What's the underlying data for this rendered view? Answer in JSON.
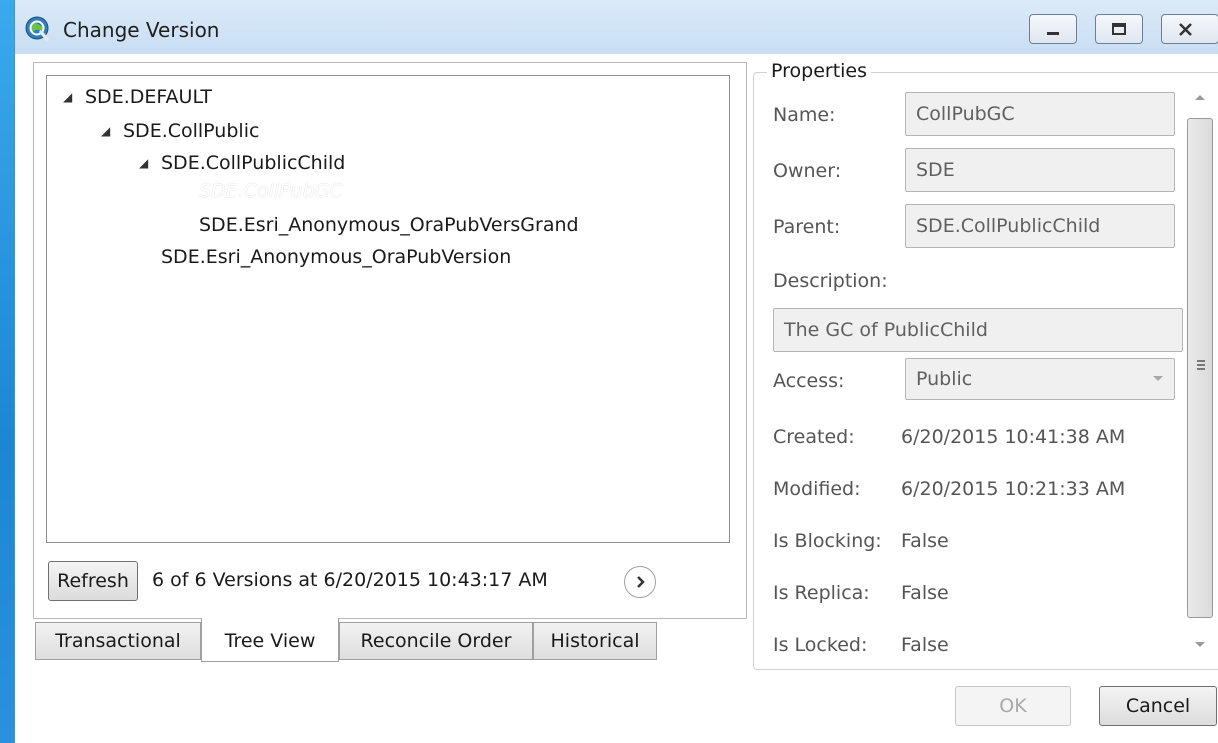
{
  "window": {
    "title": "Change Version"
  },
  "tree": {
    "nodes": [
      {
        "label": "SDE.DEFAULT",
        "expanded": true
      },
      {
        "label": "SDE.CollPublic",
        "expanded": true
      },
      {
        "label": "SDE.CollPublicChild",
        "expanded": true
      },
      {
        "label": "SDE.CollPubGC",
        "selected": true
      },
      {
        "label": "SDE.Esri_Anonymous_OraPubVersGrand"
      },
      {
        "label": "SDE.Esri_Anonymous_OraPubVersion"
      }
    ]
  },
  "footer": {
    "refresh_label": "Refresh",
    "status": "6 of 6 Versions at 6/20/2015 10:43:17 AM"
  },
  "tabs": [
    {
      "label": "Transactional"
    },
    {
      "label": "Tree View",
      "active": true
    },
    {
      "label": "Reconcile Order"
    },
    {
      "label": "Historical"
    }
  ],
  "properties": {
    "title": "Properties",
    "name_label": "Name:",
    "name_value": "CollPubGC",
    "owner_label": "Owner:",
    "owner_value": "SDE",
    "parent_label": "Parent:",
    "parent_value": "SDE.CollPublicChild",
    "description_label": "Description:",
    "description_value": "The GC of PublicChild",
    "access_label": "Access:",
    "access_value": "Public",
    "created_label": "Created:",
    "created_value": "6/20/2015 10:41:38 AM",
    "modified_label": "Modified:",
    "modified_value": "6/20/2015 10:21:33 AM",
    "is_blocking_label": "Is Blocking:",
    "is_blocking_value": "False",
    "is_replica_label": "Is Replica:",
    "is_replica_value": "False",
    "is_locked_label": "Is Locked:",
    "is_locked_value": "False"
  },
  "buttons": {
    "ok_label": "OK",
    "cancel_label": "Cancel"
  },
  "colors": {
    "desktop": "#1e8fd8",
    "titlebar": "#d3e5f7",
    "selection_text": "#ffffff"
  }
}
